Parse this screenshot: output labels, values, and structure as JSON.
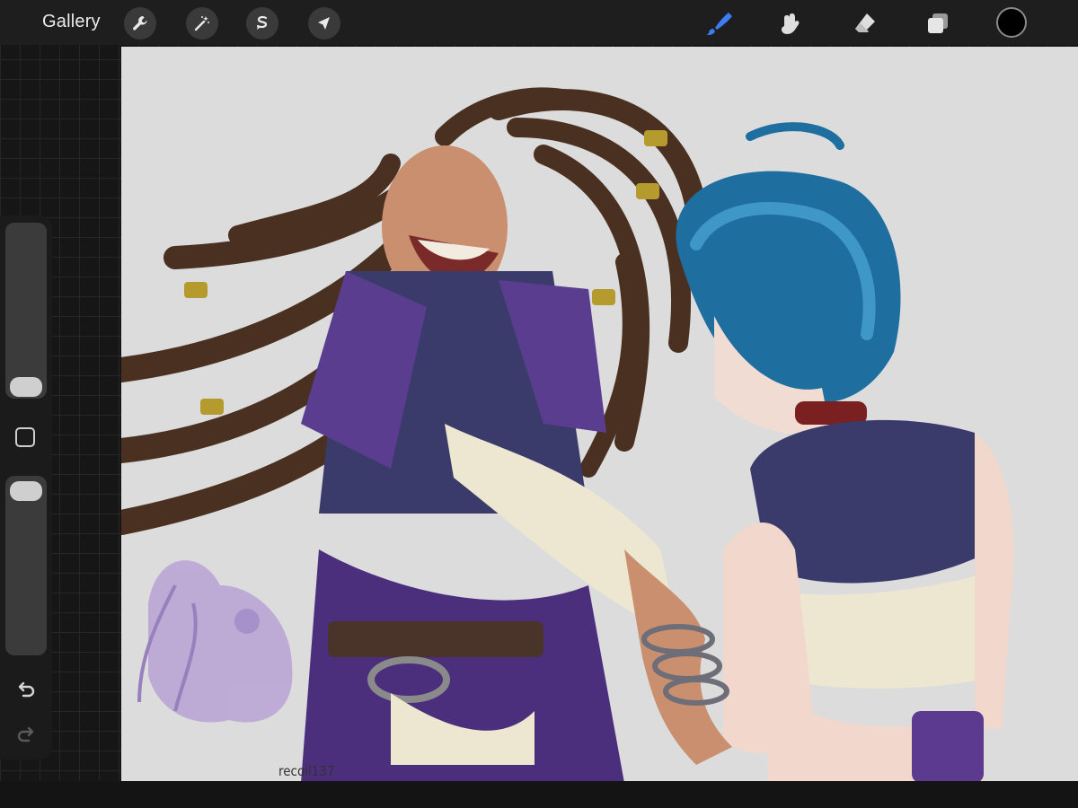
{
  "toolbar": {
    "gallery_label": "Gallery",
    "left_tools": [
      "wrench-icon",
      "magic-wand-icon",
      "selection-icon",
      "transform-arrow-icon"
    ],
    "right_tools": [
      "brush-icon",
      "smudge-icon",
      "eraser-icon",
      "layers-icon"
    ],
    "active_tool": "brush-icon",
    "active_color": "#000000",
    "accent_color": "#3d7cf2"
  },
  "sidebar": {
    "brush_size_level": 0.08,
    "opacity_level": 0.95,
    "modify_button": "square-modify-icon",
    "undo_icon": "undo-icon",
    "redo_icon": "redo-icon"
  },
  "canvas": {
    "signature": "recoil137",
    "background_color": "#dcdcdc"
  }
}
